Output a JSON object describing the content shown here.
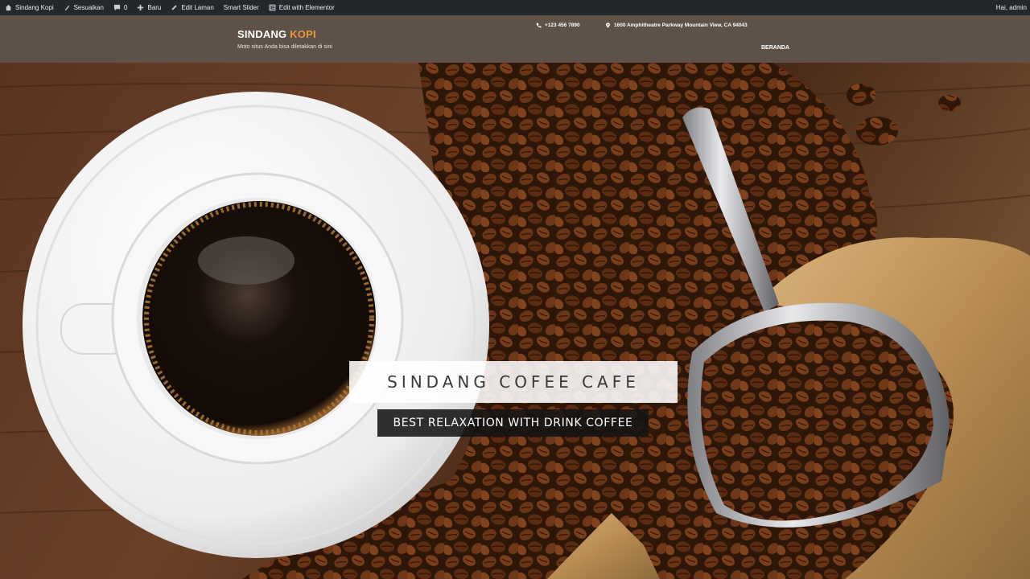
{
  "adminbar": {
    "site_name": "Sindang Kopi",
    "customize": "Sesuaikan",
    "comments_count": "0",
    "new": "Baru",
    "edit_page": "Edit Laman",
    "smart_slider": "Smart Slider",
    "elementor": "Edit with Elementor",
    "greeting": "Hai, admin"
  },
  "header": {
    "brand_main": "SINDANG ",
    "brand_accent": "KOPI",
    "tagline": "Moto situs Anda bisa diletakkan di sini",
    "phone": "+123 456 7890",
    "address": "1600 Amphitheatre Parkway Mountain View, CA 94043",
    "menu_home": "BERANDA"
  },
  "hero": {
    "title": "SINDANG COFEE CAFE",
    "subtitle": "BEST RELAXATION WITH DRINK COFFEE"
  },
  "colors": {
    "adminbar_bg": "#23282d",
    "header_bg": "#5e5248",
    "brand_accent": "#e39a3b"
  }
}
